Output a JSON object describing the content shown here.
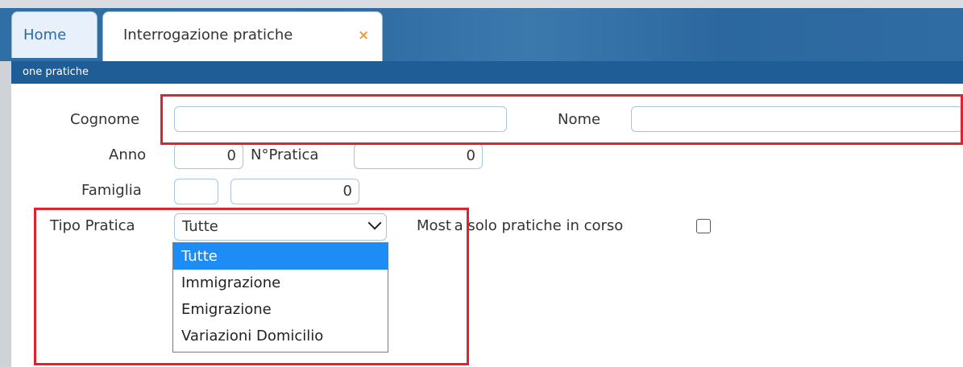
{
  "tabs": [
    {
      "label": "Home"
    },
    {
      "label": "Interrogazione pratiche",
      "close": "×"
    }
  ],
  "breadcrumb": "one pratiche",
  "form": {
    "cognome": {
      "label": "Cognome",
      "value": ""
    },
    "nome": {
      "label": "Nome",
      "value": ""
    },
    "anno": {
      "label": "Anno",
      "value": "0"
    },
    "npratica": {
      "label": "N°Pratica",
      "value": "0"
    },
    "famiglia": {
      "label": "Famiglia",
      "value1": "",
      "value2": "0"
    },
    "tipo_pratica": {
      "label": "Tipo Pratica",
      "selected": "Tutte",
      "options": [
        "Tutte",
        "Immigrazione",
        "Emigrazione",
        "Variazioni Domicilio"
      ]
    },
    "mostra_solo": {
      "label": "Most a solo pratiche in corso",
      "checked": false
    }
  },
  "colors": {
    "accent": "#1f5d96",
    "highlight": "#e0222e",
    "selected_option": "#1e8cf5",
    "close_icon": "#f29b2e"
  }
}
